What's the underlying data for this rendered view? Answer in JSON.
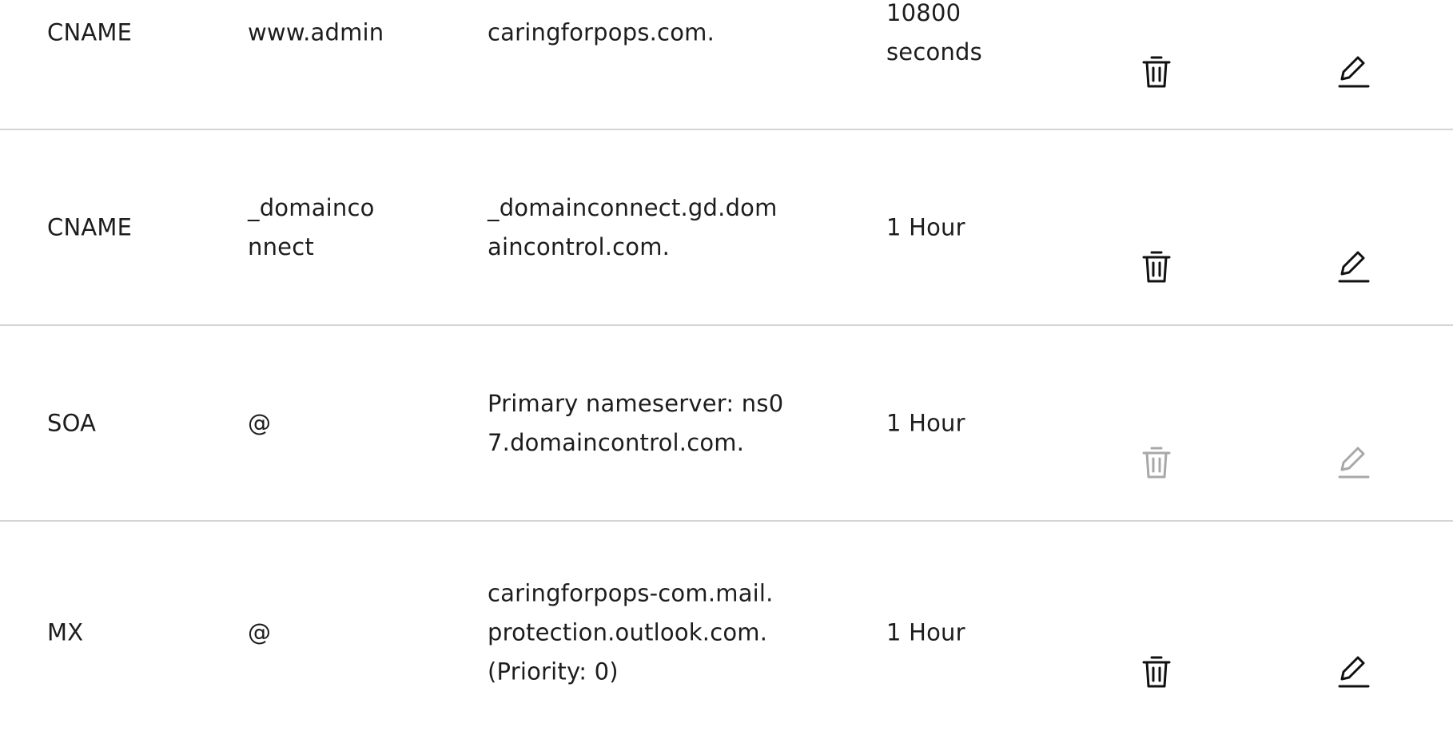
{
  "dns_records": {
    "rows": [
      {
        "type": "CNAME",
        "name": "www.admin",
        "value": "caringforpops.com.",
        "ttl": "10800\nseconds",
        "actions_enabled": true
      },
      {
        "type": "CNAME",
        "name": "_domainco\nnnect",
        "value": "_domainconnect.gd.dom\naincontrol.com.",
        "ttl": "1 Hour",
        "actions_enabled": true
      },
      {
        "type": "SOA",
        "name": "@",
        "value": "Primary nameserver: ns0\n7.domaincontrol.com.",
        "ttl": "1 Hour",
        "actions_enabled": false
      },
      {
        "type": "MX",
        "name": "@",
        "value": "caringforpops-com.mail.\nprotection.outlook.com.\n(Priority: 0)",
        "ttl": "1 Hour",
        "actions_enabled": true
      }
    ]
  },
  "icons": {
    "delete": "trash-icon",
    "edit": "pencil-icon"
  },
  "colors": {
    "text": "#1d1d1d",
    "icon_enabled": "#111111",
    "icon_disabled": "#a8a8a8",
    "divider": "#d4d4d4"
  }
}
